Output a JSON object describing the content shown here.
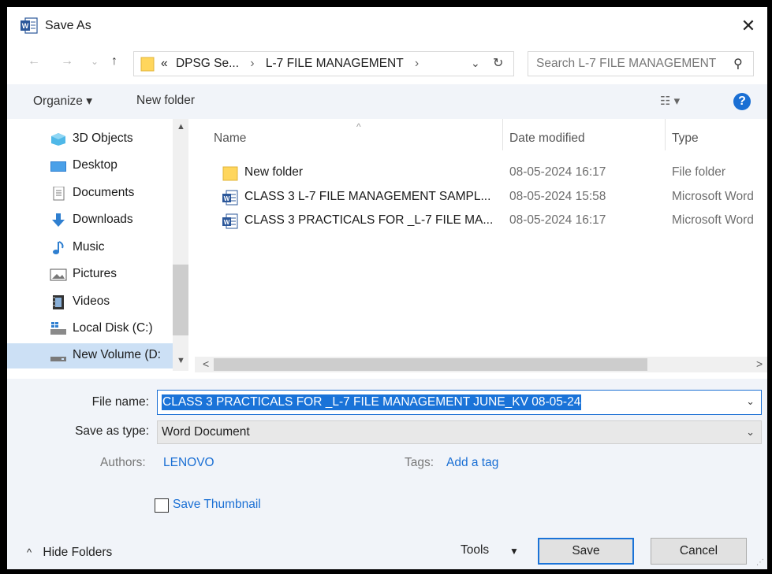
{
  "window": {
    "title": "Save As",
    "close_symbol": "✕"
  },
  "nav": {
    "back": "←",
    "forward": "→",
    "recent": "⌄",
    "up": "↑",
    "address": {
      "overflow": "«",
      "crumbs": [
        "DPSG Se...",
        "L-7 FILE MANAGEMENT"
      ],
      "separator": "›",
      "dropdown": "⌄",
      "refresh": "↻"
    },
    "search": {
      "placeholder": "Search L-7 FILE MANAGEMENT",
      "icon": "⚲"
    }
  },
  "toolbar": {
    "organize": "Organize ▾",
    "new_folder": "New folder",
    "view": "☷ ▾",
    "help": "?"
  },
  "sidebar": {
    "items": [
      {
        "label": "3D Objects",
        "icon": "3d-objects-icon"
      },
      {
        "label": "Desktop",
        "icon": "desktop-icon"
      },
      {
        "label": "Documents",
        "icon": "documents-icon"
      },
      {
        "label": "Downloads",
        "icon": "downloads-icon"
      },
      {
        "label": "Music",
        "icon": "music-icon"
      },
      {
        "label": "Pictures",
        "icon": "pictures-icon"
      },
      {
        "label": "Videos",
        "icon": "videos-icon"
      },
      {
        "label": "Local Disk (C:)",
        "icon": "local-disk-icon"
      },
      {
        "label": "New Volume (D:",
        "icon": "drive-icon",
        "selected": true
      }
    ],
    "scroll_up": "▲",
    "scroll_down": "▼"
  },
  "files": {
    "headers": {
      "name": "Name",
      "date": "Date modified",
      "type": "Type",
      "sort": "^"
    },
    "rows": [
      {
        "name": "New folder",
        "date": "08-05-2024 16:17",
        "type": "File folder",
        "icon": "folder-icon"
      },
      {
        "name": "CLASS 3 L-7 FILE MANAGEMENT SAMPL...",
        "date": "08-05-2024 15:58",
        "type": "Microsoft Word",
        "icon": "word-doc-icon"
      },
      {
        "name": "CLASS 3 PRACTICALS FOR _L-7 FILE MA...",
        "date": "08-05-2024 16:17",
        "type": "Microsoft Word",
        "icon": "word-doc-icon"
      }
    ],
    "scroll_left": "<",
    "scroll_right": ">"
  },
  "form": {
    "file_name_label": "File name:",
    "file_name_value": "CLASS 3 PRACTICALS FOR _L-7 FILE MANAGEMENT JUNE_KV 08-05-24",
    "save_as_type_label": "Save as type:",
    "save_as_type_value": "Word Document",
    "dropdown_arrow": "⌄",
    "authors_label": "Authors:",
    "authors_value": "LENOVO",
    "tags_label": "Tags:",
    "tags_value": "Add a tag",
    "thumbnail_label": "Save Thumbnail",
    "thumbnail_checked": false
  },
  "footer": {
    "hide_folders": "Hide Folders",
    "hide_folders_chevron": "^",
    "tools": "Tools",
    "tools_arrow": "▼",
    "save": "Save",
    "cancel": "Cancel"
  },
  "colors": {
    "accent": "#1a6fd4",
    "selection": "#1a73d8",
    "sidebar_selected": "#cce0f5",
    "toolbar_bg": "#f1f4f9"
  }
}
